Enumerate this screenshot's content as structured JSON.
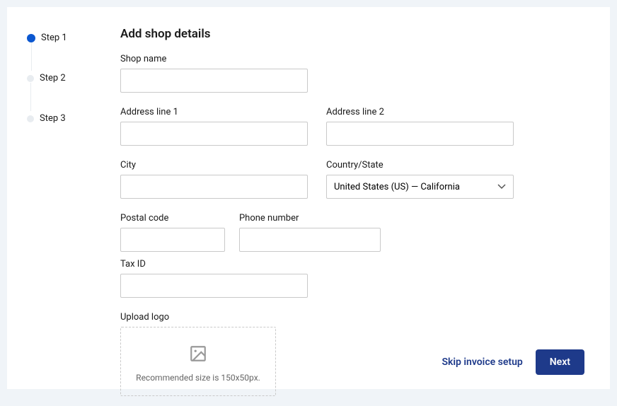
{
  "stepper": {
    "items": [
      {
        "label": "Step 1",
        "active": true
      },
      {
        "label": "Step 2",
        "active": false
      },
      {
        "label": "Step 3",
        "active": false
      }
    ]
  },
  "heading": "Add shop details",
  "fields": {
    "shop_name_label": "Shop name",
    "shop_name_value": "",
    "address1_label": "Address line 1",
    "address1_value": "",
    "address2_label": "Address line 2",
    "address2_value": "",
    "city_label": "City",
    "city_value": "",
    "country_label": "Country/State",
    "country_value": "United States (US) — California",
    "postal_label": "Postal code",
    "postal_value": "",
    "phone_label": "Phone number",
    "phone_value": "",
    "tax_label": "Tax ID",
    "tax_value": "",
    "logo_label": "Upload logo",
    "logo_hint": "Recommended size is 150x50px."
  },
  "footer": {
    "skip_label": "Skip invoice setup",
    "next_label": "Next"
  }
}
